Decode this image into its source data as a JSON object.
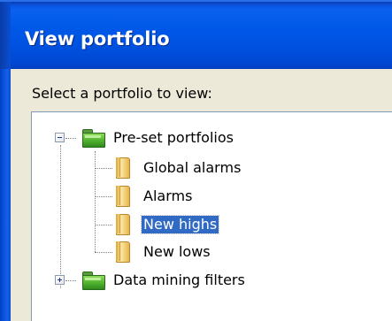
{
  "window": {
    "title": "View portfolio"
  },
  "dialog": {
    "prompt": "Select a portfolio to view:"
  },
  "tree": {
    "root_nodes": [
      {
        "label": "Pre-set portfolios",
        "expanded": true,
        "icon": "folder-icon",
        "children": [
          {
            "label": "Global alarms",
            "icon": "portfolio-icon",
            "selected": false
          },
          {
            "label": "Alarms",
            "icon": "portfolio-icon",
            "selected": false
          },
          {
            "label": "New highs",
            "icon": "portfolio-icon",
            "selected": true
          },
          {
            "label": "New lows",
            "icon": "portfolio-icon",
            "selected": false
          }
        ]
      },
      {
        "label": "Data mining filters",
        "expanded": false,
        "icon": "folder-icon",
        "children": []
      }
    ]
  },
  "colors": {
    "titlebar": "#0058e8",
    "selection": "#316ac5",
    "folder": "#4fb12f",
    "portfolio_item": "#f6d277"
  }
}
